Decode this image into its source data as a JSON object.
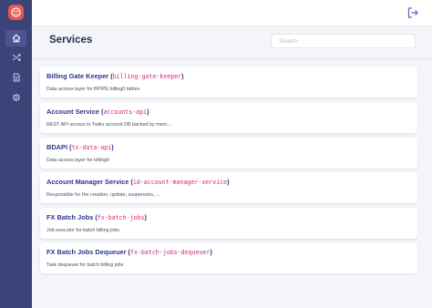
{
  "header": {
    "title": "Services",
    "search_placeholder": "Search"
  },
  "sidebar": {
    "items": [
      {
        "name": "home",
        "icon": "home-icon",
        "active": true
      },
      {
        "name": "shuffle",
        "icon": "shuffle-icon",
        "active": false
      },
      {
        "name": "document",
        "icon": "document-icon",
        "active": false
      },
      {
        "name": "settings",
        "icon": "gear-icon",
        "active": false
      }
    ]
  },
  "colors": {
    "sidebar": "#3b4378",
    "title": "#2e3591",
    "code": "#d8257c",
    "logo": "#e55a4d"
  },
  "services": [
    {
      "name": "Billing Gate Keeper",
      "id": "billing-gate-keeper",
      "description": "Data access layer for BPIPE billing0 tables"
    },
    {
      "name": "Account Service",
      "id": "accounts-api",
      "description": "REST API access to Twilio account DB backed by mem..."
    },
    {
      "name": "BDAPI",
      "id": "tx-data-api",
      "description": "Data access layer for billing0"
    },
    {
      "name": "Account Manager Service",
      "id": "id-account-manager-service",
      "description": "Responsible for the creation, update, suspension, ..."
    },
    {
      "name": "FX Batch Jobs",
      "id": "fx-batch-jobs",
      "description": "Job executor for batch billing jobs"
    },
    {
      "name": "FX Batch Jobs Dequeuer",
      "id": "fx-batch-jobs-dequeuer",
      "description": "Task dequeuer for batch billing jobs"
    }
  ]
}
